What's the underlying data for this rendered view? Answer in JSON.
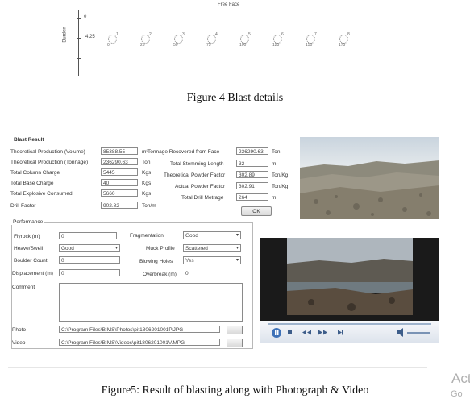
{
  "figure4": {
    "free_face": "Free Face",
    "y_axis_label": "Burden",
    "y_tick_0": "0",
    "y_tick_1": "4.25",
    "holes": [
      {
        "id": "1",
        "delay": "0"
      },
      {
        "id": "2",
        "delay": "25"
      },
      {
        "id": "3",
        "delay": "50"
      },
      {
        "id": "4",
        "delay": "75"
      },
      {
        "id": "5",
        "delay": "100"
      },
      {
        "id": "6",
        "delay": "125"
      },
      {
        "id": "7",
        "delay": "150"
      },
      {
        "id": "8",
        "delay": "175"
      }
    ],
    "caption": "Figure 4 Blast details"
  },
  "blast_result": {
    "title": "Blast Result",
    "left_fields": [
      {
        "label": "Theoretical Production (Volume)",
        "value": "85388.55",
        "unit": "m³"
      },
      {
        "label": "Theoretical Production (Tonnage)",
        "value": "236290.63",
        "unit": "Ton"
      },
      {
        "label": "Total Column Charge",
        "value": "5445",
        "unit": "Kgs"
      },
      {
        "label": "Total Base Charge",
        "value": "40",
        "unit": "Kgs"
      },
      {
        "label": "Total Explosive Consumed",
        "value": "5660",
        "unit": "Kgs"
      },
      {
        "label": "Drill Factor",
        "value": "902.82",
        "unit": "Ton/m"
      }
    ],
    "right_fields": [
      {
        "label": "Tonnage Recovered from Face",
        "value": "236290.63",
        "unit": "Ton"
      },
      {
        "label": "Total Stemming Length",
        "value": "32",
        "unit": "m"
      },
      {
        "label": "Theoretical Powder Factor",
        "value": "302.89",
        "unit": "Ton/Kg"
      },
      {
        "label": "Actual Powder Factor",
        "value": "302.91",
        "unit": "Ton/Kg"
      },
      {
        "label": "Total Drill Metrage",
        "value": "264",
        "unit": "m"
      }
    ],
    "ok_label": "OK",
    "performance": {
      "legend": "Performance",
      "flyrock_label": "Flyrock (m)",
      "flyrock_value": "0",
      "fragmentation_label": "Fragmentation",
      "fragmentation_value": "Good",
      "heave_label": "Heave/Swell",
      "heave_value": "Good",
      "muck_label": "Muck Profile",
      "muck_value": "Scattered",
      "boulder_label": "Boulder Count",
      "boulder_value": "0",
      "blowing_label": "Blowing Holes",
      "blowing_value": "Yes",
      "displacement_label": "Displacement (m)",
      "displacement_value": "0",
      "overbreak_label": "Overbreak (m)",
      "overbreak_value": "0",
      "comment_label": "Comment",
      "comment_value": "",
      "photo_label": "Photo",
      "photo_path": "C:\\Program Files\\BIMS\\Photos\\pit1806201001P.JPG",
      "video_label": "Video",
      "video_path": "C:\\Program Files\\BIMS\\Videos\\pit1806201001V.MPG",
      "browse_label": "..."
    }
  },
  "fig5_caption": "Figure5: Result of blasting along with Photograph & Video",
  "watermark": {
    "line1": "Act",
    "line2": "Go"
  }
}
